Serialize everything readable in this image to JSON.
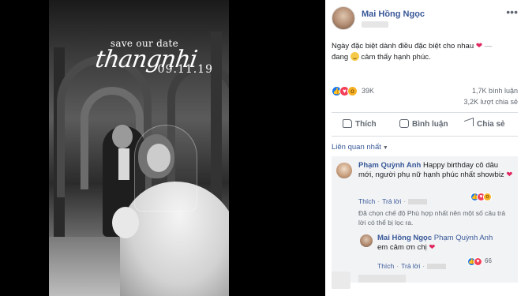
{
  "photo": {
    "overlay_top": "save our date",
    "overlay_script": "thangnhi",
    "overlay_date": "09.11.19"
  },
  "post": {
    "author": "Mai Hồng Ngọc",
    "more_icon": "ellipsis-icon",
    "status_text": "Ngày đặc biệt dành điều đặc biệt cho nhau",
    "status_heart": "❤",
    "status_dash": "—",
    "feeling_prefix": "đang",
    "feeling_text": "cảm thấy hạnh phúc."
  },
  "stats": {
    "reaction_count": "39K",
    "comments": "1,7K bình luận",
    "shares": "3,2K lượt chia sẻ"
  },
  "actions": {
    "like": "Thích",
    "comment": "Bình luận",
    "share": "Chia sẻ"
  },
  "comments": {
    "filter_label": "Liên quan nhất",
    "filter_caret": "▼",
    "first": {
      "name": "Phạm Quỳnh Anh",
      "text": "Happy birthday cô dâu mới, người phụ nữ hạnh phúc nhất showbiz",
      "heart": "❤",
      "react_count": "",
      "like_label": "Thích",
      "reply_label": "Trả lời",
      "sep": "·"
    },
    "notice": "Đã chọn chế độ Phù hợp nhất nên một số câu trả lời có thể bị lọc ra.",
    "reply": {
      "name": "Mai Hồng Ngọc",
      "tagged": "Phạm Quỳnh Anh",
      "text": "em cảm ơn chị",
      "heart": "❤",
      "react_count": "66",
      "like_label": "Thích",
      "reply_label": "Trả lời",
      "sep": "·"
    }
  },
  "colors": {
    "link": "#385898",
    "like_blue": "#1877f2",
    "love_red": "#f33e58",
    "panel_bg": "#ffffff",
    "comment_bg": "#f2f3f5"
  }
}
